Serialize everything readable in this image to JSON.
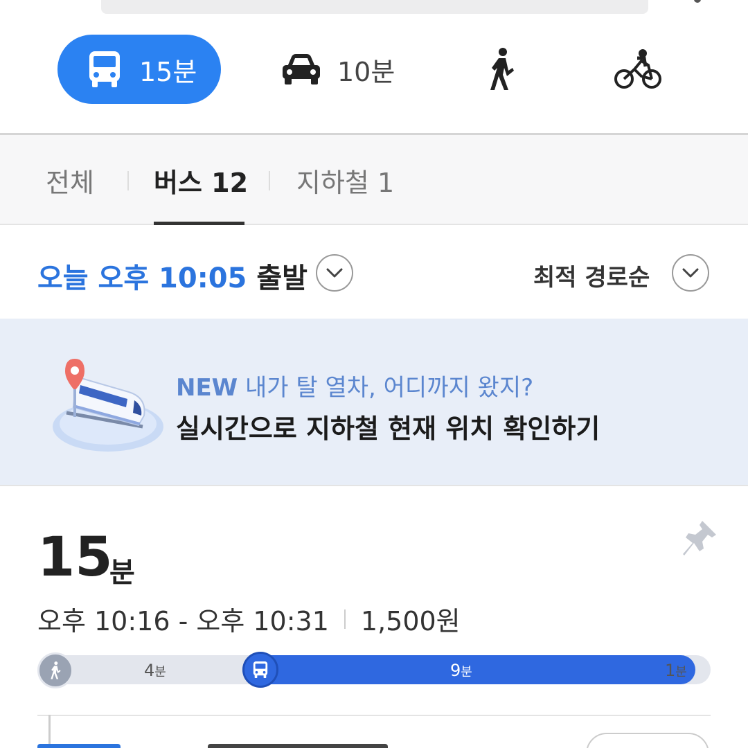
{
  "modes": {
    "bus": {
      "icon": "bus-icon",
      "label": "15분"
    },
    "car": {
      "icon": "car-icon",
      "label": "10분"
    },
    "walk": {
      "icon": "walk-icon"
    },
    "bike": {
      "icon": "bike-icon"
    }
  },
  "tabs": [
    {
      "label": "전체"
    },
    {
      "label": "버스 12"
    },
    {
      "label": "지하철 1"
    }
  ],
  "departure": {
    "time": "오늘 오후 10:05",
    "word": "출발",
    "sort": "최적 경로순"
  },
  "banner": {
    "new": "NEW",
    "line1": "내가 탈 열차, 어디까지 왔지?",
    "line2": "실시간으로 지하철 현재 위치 확인하기"
  },
  "route": {
    "duration": "15",
    "duration_unit": "분",
    "time_range": "오후 10:16 - 오후 10:31",
    "fare": "1,500원",
    "segments": [
      {
        "mode": "walk",
        "value": "4",
        "unit": "분"
      },
      {
        "mode": "bus",
        "value": "9",
        "unit": "분"
      },
      {
        "mode": "walk",
        "value": "1",
        "unit": "분"
      }
    ]
  },
  "colors": {
    "accent": "#2b82f2",
    "bus_bar": "#2f68e0",
    "depart_time": "#2b74de"
  }
}
